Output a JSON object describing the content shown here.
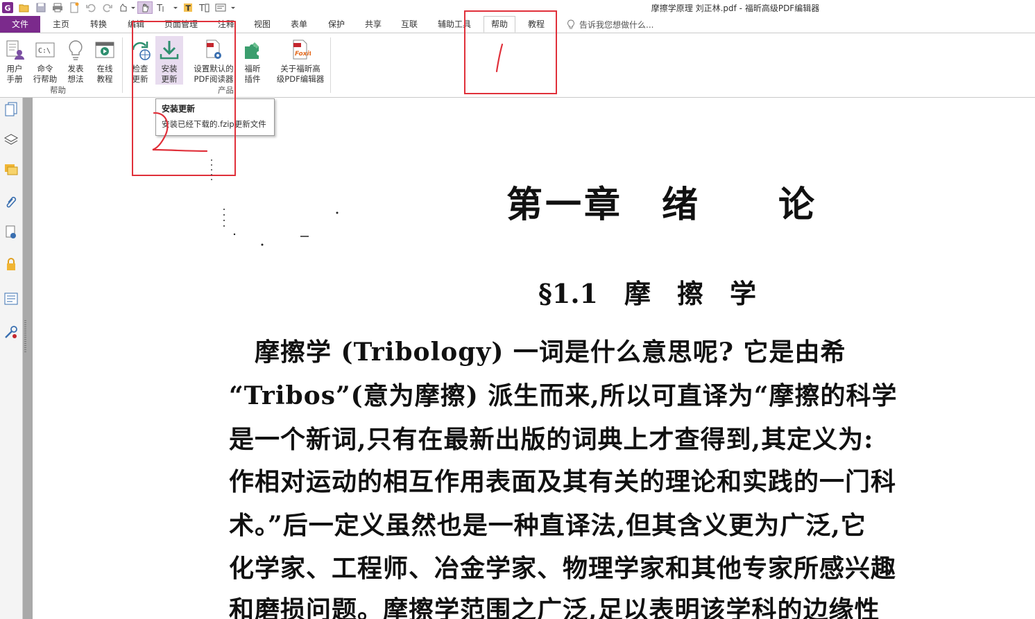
{
  "window": {
    "title": "摩擦学原理 刘正林.pdf - 福昕高级PDF编辑器"
  },
  "menu": {
    "file": "文件",
    "tabs": [
      "主页",
      "转换",
      "编辑",
      "页面管理",
      "注释",
      "视图",
      "表单",
      "保护",
      "共享",
      "互联",
      "辅助工具",
      "帮助",
      "教程"
    ],
    "tell_me": "告诉我您想做什么..."
  },
  "ribbon": {
    "help_group": {
      "label": "帮助",
      "buttons": [
        {
          "line1": "用户",
          "line2": "手册"
        },
        {
          "line1": "命令",
          "line2": "行帮助"
        },
        {
          "line1": "发表",
          "line2": "想法"
        },
        {
          "line1": "在线",
          "line2": "教程"
        }
      ]
    },
    "product_group": {
      "label": "产品",
      "buttons": [
        {
          "line1": "检查",
          "line2": "更新"
        },
        {
          "line1": "安装",
          "line2": "更新"
        },
        {
          "line1": "设置默认的",
          "line2": "PDF阅读器"
        },
        {
          "line1": "福昕",
          "line2": "插件"
        },
        {
          "line1": "关于福昕高",
          "line2": "级PDF编辑器"
        }
      ]
    },
    "cmd_icon_text": "C:\\"
  },
  "tooltip": {
    "title": "安装更新",
    "description": "安装已经下载的.fzip更新文件"
  },
  "document": {
    "chapter_title": "第一章　绪　　论",
    "section_title": "§1.1　摩　擦　学",
    "paragraph_lines": [
      "　摩擦学 (Tribology) 一词是什么意思呢? 它是由希",
      "“Tribos”(意为摩擦) 派生而来,所以可直译为“摩擦的科学",
      "是一个新词,只有在最新出版的词典上才查得到,其定义为:",
      "作相对运动的相互作用表面及其有关的理论和实践的一门科",
      "术。”后一定义虽然也是一种直译法,但其含义更为广泛,它",
      "化学家、工程师、冶金学家、物理学家和其他专家所感兴趣",
      "和磨损问题。摩擦学范围之广泛,足以表明该学科的边缘性"
    ]
  },
  "colors": {
    "accent": "#7b2a8c",
    "annotation_red": "#e0303a"
  }
}
